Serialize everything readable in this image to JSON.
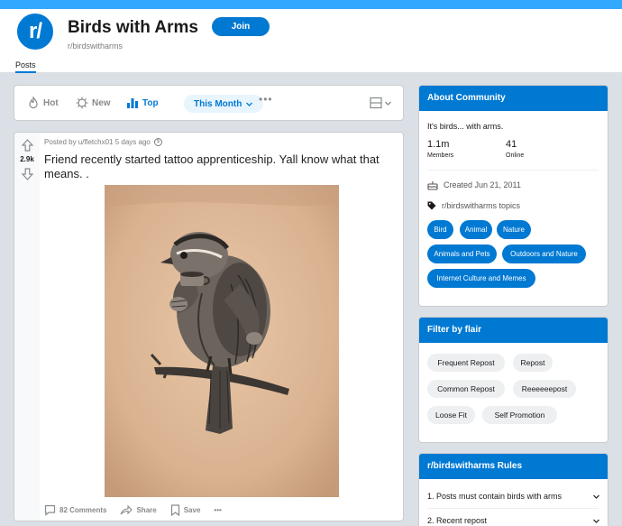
{
  "subreddit": {
    "avatar_text": "r/",
    "title": "Birds with Arms",
    "name": "r/birdswitharms",
    "join_label": "Join",
    "tab_posts": "Posts"
  },
  "sort_bar": {
    "hot": "Hot",
    "new": "New",
    "top": "Top",
    "time_filter": "This Month",
    "more": "•••"
  },
  "post": {
    "score": "2.9k",
    "meta": "Posted by u/fletchx01 5 days ago",
    "title": "Friend recently started tattoo apprenticeship. Yall know what that means. .",
    "image_alt": "tattoo of a bird holding a teacup",
    "comments": "82 Comments",
    "share": "Share",
    "save": "Save",
    "more": "•••"
  },
  "about": {
    "heading": "About Community",
    "description": "It's birds... with arms.",
    "members_count": "1.1m",
    "members_label": "Members",
    "online_count": "41",
    "online_label": "Online",
    "created": "Created Jun 21, 2011",
    "topics_label": "r/birdswitharms topics",
    "topics": [
      "Bird",
      "Animal",
      "Nature",
      "Animals and Pets",
      "Outdoors and Nature",
      "Internet Culture and Memes"
    ]
  },
  "flair": {
    "heading": "Filter by flair",
    "items": [
      "Frequent Repost",
      "Repost",
      "Common Repost",
      "Reeeeeepost",
      "Loose Fit",
      "Self Promotion"
    ]
  },
  "rules": {
    "heading": "r/birdswitharms Rules",
    "items": [
      "1. Posts must contain birds with arms",
      "2. Recent repost"
    ]
  },
  "colors": {
    "accent": "#0079d3",
    "banner": "#33a8ff",
    "background": "#dae0e6"
  }
}
